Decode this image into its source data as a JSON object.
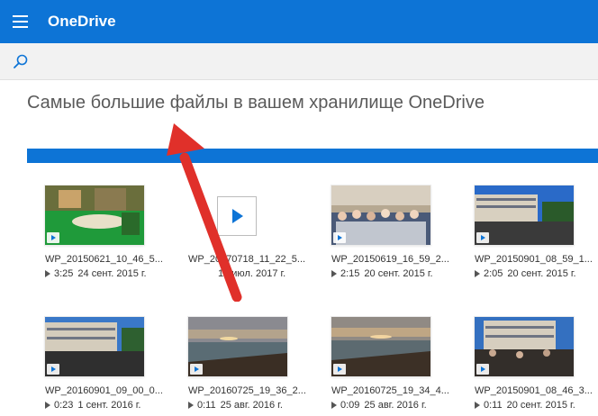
{
  "header": {
    "title": "OneDrive",
    "accent": "#0d74d6"
  },
  "page": {
    "title": "Самые большие файлы в вашем хранилище OneDrive"
  },
  "icons": {
    "menu": "hamburger-menu-icon",
    "search": "search-icon",
    "play": "play-icon"
  },
  "files": [
    {
      "name": "WP_20150621_10_46_5...",
      "duration": "3:25",
      "date": "24 сент. 2015 г."
    },
    {
      "name": "WP_20170718_11_22_5...",
      "duration": "",
      "date": "18 июл. 2017 г."
    },
    {
      "name": "WP_20150619_16_59_2...",
      "duration": "2:15",
      "date": "20 сент. 2015 г."
    },
    {
      "name": "WP_20150901_08_59_1...",
      "duration": "2:05",
      "date": "20 сент. 2015 г."
    },
    {
      "name": "WP_20160901_09_00_0...",
      "duration": "0:23",
      "date": "1 сент. 2016 г."
    },
    {
      "name": "WP_20160725_19_36_2...",
      "duration": "0:11",
      "date": "25 авг. 2016 г."
    },
    {
      "name": "WP_20160725_19_34_4...",
      "duration": "0:09",
      "date": "25 авг. 2016 г."
    },
    {
      "name": "WP_20150901_08_46_3...",
      "duration": "0:11",
      "date": "20 сент. 2015 г."
    }
  ]
}
